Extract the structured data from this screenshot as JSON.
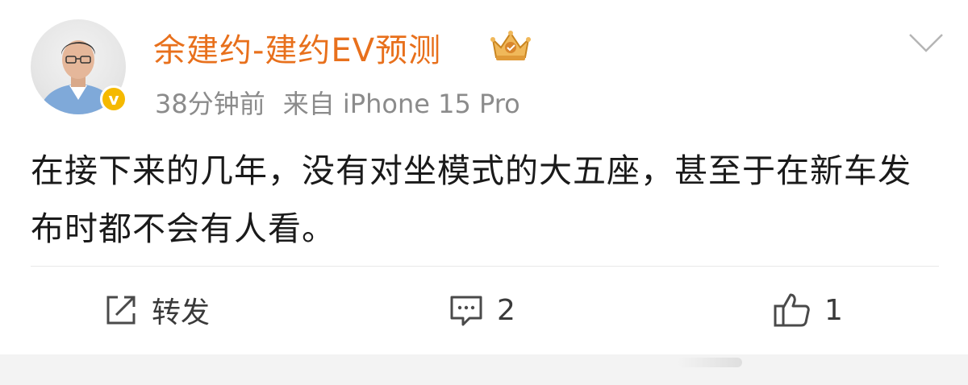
{
  "post": {
    "author": {
      "name": "余建约-建约EV预测",
      "verified_mark": "v",
      "avatar_icon": "person-avatar",
      "badge_icon": "crown-icon"
    },
    "meta": {
      "time": "38分钟前",
      "source": "来自 iPhone 15 Pro"
    },
    "content": "在接下来的几年，没有对坐模式的大五座，甚至于在新车发布时都不会有人看。",
    "actions": {
      "repost_label": "转发",
      "comment_count": "2",
      "like_count": "1"
    }
  },
  "colors": {
    "username": "#e8701c",
    "meta": "#8b8b8b",
    "verified": "#f5b900",
    "text": "#1a1a1a"
  }
}
